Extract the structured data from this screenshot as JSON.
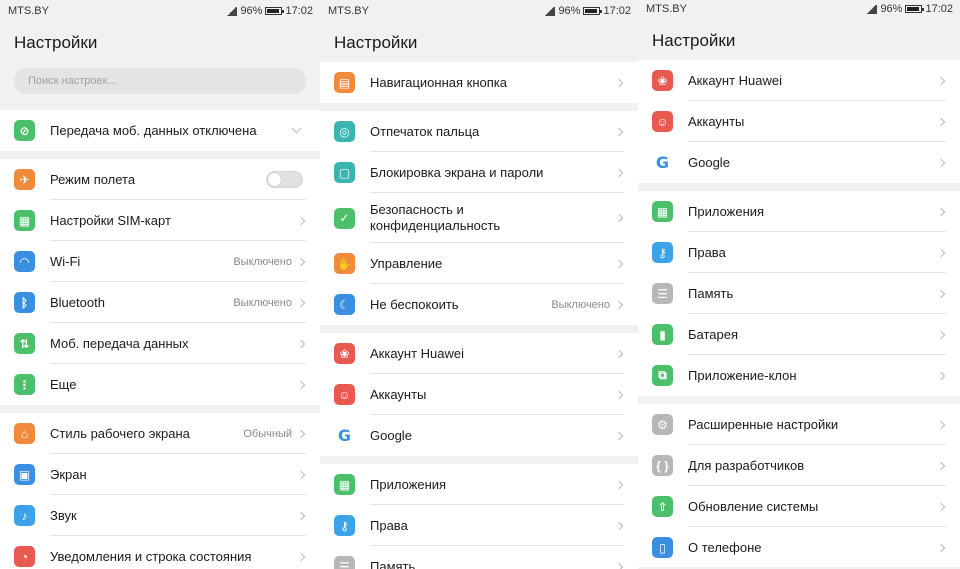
{
  "status": {
    "carrier": "MTS.BY",
    "battery": "96%",
    "time": "17:02"
  },
  "screen1": {
    "title": "Настройки",
    "search_placeholder": "Поиск настроек...",
    "groups": [
      [
        {
          "label": "Передача моб. данных отключена",
          "icon": "data-off-icon"
        }
      ],
      [
        {
          "label": "Режим полета",
          "icon": "airplane-icon"
        },
        {
          "label": "Настройки SIM-карт",
          "icon": "sim-icon"
        },
        {
          "label": "Wi-Fi",
          "value": "Выключено",
          "icon": "wifi-icon"
        },
        {
          "label": "Bluetooth",
          "value": "Выключено",
          "icon": "bluetooth-icon"
        },
        {
          "label": "Моб. передача данных",
          "icon": "mobile-data-icon"
        },
        {
          "label": "Еще",
          "icon": "more-icon"
        }
      ],
      [
        {
          "label": "Стиль рабочего экрана",
          "value": "Обычный",
          "icon": "home-icon"
        },
        {
          "label": "Экран",
          "icon": "display-icon"
        },
        {
          "label": "Звук",
          "icon": "sound-icon"
        },
        {
          "label": "Уведомления и строка состояния",
          "icon": "notification-icon"
        }
      ]
    ]
  },
  "screen2": {
    "title": "Настройки",
    "groups": [
      [
        {
          "label": "Навигационная кнопка",
          "icon": "nav-button-icon"
        }
      ],
      [
        {
          "label": "Отпечаток пальца",
          "icon": "fingerprint-icon"
        },
        {
          "label": "Блокировка экрана и пароли",
          "icon": "lock-icon"
        },
        {
          "label": "Безопасность и конфиденциальность",
          "icon": "shield-icon"
        },
        {
          "label": "Управление",
          "icon": "hand-icon"
        },
        {
          "label": "Не беспокоить",
          "value": "Выключено",
          "icon": "moon-icon"
        }
      ],
      [
        {
          "label": "Аккаунт Huawei",
          "icon": "huawei-icon"
        },
        {
          "label": "Аккаунты",
          "icon": "account-icon"
        },
        {
          "label": "Google",
          "icon": "google-icon"
        }
      ],
      [
        {
          "label": "Приложения",
          "icon": "apps-icon"
        },
        {
          "label": "Права",
          "icon": "key-icon"
        },
        {
          "label": "Память",
          "icon": "storage-icon"
        }
      ]
    ]
  },
  "screen3": {
    "title": "Настройки",
    "groups": [
      [
        {
          "label": "Аккаунт Huawei",
          "icon": "huawei-icon"
        },
        {
          "label": "Аккаунты",
          "icon": "account-icon"
        },
        {
          "label": "Google",
          "icon": "google-icon"
        }
      ],
      [
        {
          "label": "Приложения",
          "icon": "apps-icon"
        },
        {
          "label": "Права",
          "icon": "key-icon"
        },
        {
          "label": "Память",
          "icon": "storage-icon"
        },
        {
          "label": "Батарея",
          "icon": "battery-icon"
        },
        {
          "label": "Приложение-клон",
          "icon": "clone-icon"
        }
      ],
      [
        {
          "label": "Расширенные настройки",
          "icon": "gear-icon"
        },
        {
          "label": "Для разработчиков",
          "icon": "braces-icon"
        },
        {
          "label": "Обновление системы",
          "icon": "update-icon"
        },
        {
          "label": "О телефоне",
          "icon": "phone-icon"
        }
      ]
    ]
  }
}
